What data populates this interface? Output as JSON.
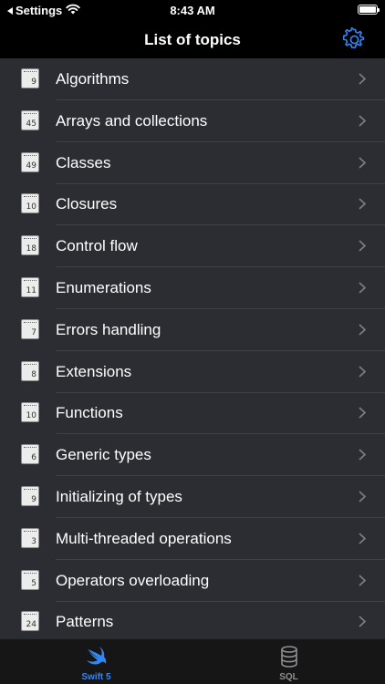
{
  "status_bar": {
    "back_label": "Settings",
    "time": "8:43 AM"
  },
  "nav": {
    "title": "List of topics"
  },
  "topics": [
    {
      "label": "Algorithms",
      "count": "9"
    },
    {
      "label": "Arrays and collections",
      "count": "45"
    },
    {
      "label": "Classes",
      "count": "49"
    },
    {
      "label": "Closures",
      "count": "10"
    },
    {
      "label": "Control flow",
      "count": "18"
    },
    {
      "label": "Enumerations",
      "count": "11"
    },
    {
      "label": "Errors handling",
      "count": "7"
    },
    {
      "label": "Extensions",
      "count": "8"
    },
    {
      "label": "Functions",
      "count": "10"
    },
    {
      "label": "Generic types",
      "count": "6"
    },
    {
      "label": "Initializing of types",
      "count": "9"
    },
    {
      "label": "Multi-threaded operations",
      "count": "3"
    },
    {
      "label": "Operators overloading",
      "count": "5"
    },
    {
      "label": "Patterns",
      "count": "24"
    }
  ],
  "tabs": [
    {
      "label": "Swift 5",
      "icon": "swift-icon",
      "selected": true
    },
    {
      "label": "SQL",
      "icon": "database-icon",
      "selected": false
    }
  ],
  "colors": {
    "accent": "#2f86f6",
    "list_bg": "#2b2d33",
    "bar_bg": "#000000"
  }
}
